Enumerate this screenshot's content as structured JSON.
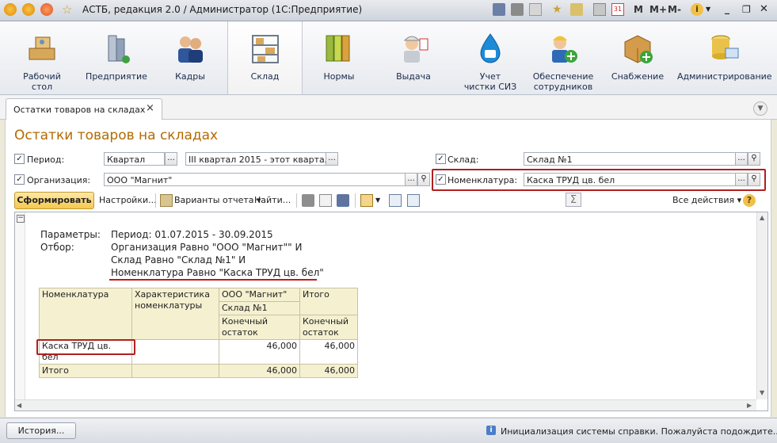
{
  "window": {
    "title": "АСТБ, редакция 2.0 / Администратор  (1С:Предприятие)",
    "mplus": [
      "M",
      "M+",
      "M-"
    ]
  },
  "sections": [
    {
      "label": "Рабочий\nстол",
      "icon": "desk-icon"
    },
    {
      "label": "Предприятие",
      "icon": "building-icon"
    },
    {
      "label": "Кадры",
      "icon": "people-icon"
    },
    {
      "label": "Склад",
      "icon": "warehouse-shelf-icon"
    },
    {
      "label": "Нормы",
      "icon": "binders-icon"
    },
    {
      "label": "Выдача",
      "icon": "worker-icon"
    },
    {
      "label": "Учет\nчистки СИЗ",
      "icon": "water-drop-icon"
    },
    {
      "label": "Обеспечение\nсотрудников",
      "icon": "worker-add-icon"
    },
    {
      "label": "Снабжение",
      "icon": "box-add-icon"
    },
    {
      "label": "Администрирование",
      "icon": "database-icon"
    }
  ],
  "tab": {
    "label": "Остатки товаров на складах",
    "close": "×"
  },
  "page": {
    "title": "Остатки товаров на складах"
  },
  "filters": {
    "period_label": "Период:",
    "period_kind": "Квартал",
    "period_value": "III квартал 2015 - этот квартал",
    "org_label": "Организация:",
    "org_value": "ООО \"Магнит\"",
    "warehouse_label": "Склад:",
    "warehouse_value": "Склад №1",
    "nomenclature_label": "Номенклатура:",
    "nomenclature_value": "Каска ТРУД цв. бел",
    "dots": "...",
    "magnifier": "🔍"
  },
  "toolbar": {
    "form_button": "Сформировать",
    "settings": "Настройки...",
    "variants": "Варианты отчета",
    "find": "Найти...",
    "all_actions": "Все действия",
    "sum": "Σ",
    "help": "?"
  },
  "report": {
    "params_label": "Параметры:",
    "params_value": "Период: 01.07.2015 - 30.09.2015",
    "filter_label": "Отбор:",
    "filter_lines": [
      "Организация Равно \"ООО \"Магнит\"\" И",
      "Склад Равно \"Склад №1\" И",
      "Номенклатура Равно \"Каска ТРУД цв. бел\""
    ],
    "table": {
      "col_nomenclature": "Номенклатура",
      "col_characteristic": "Характеристика номенклатуры",
      "col_org": "ООО \"Магнит\"",
      "col_warehouse": "Склад №1",
      "col_total": "Итого",
      "col_end_balance": "Конечный остаток",
      "rows": [
        {
          "name": "Каска ТРУД цв. бел",
          "char": "",
          "org_value": "46,000",
          "total": "46,000"
        }
      ],
      "total_label": "Итого",
      "total_org": "46,000",
      "total_total": "46,000"
    }
  },
  "status": {
    "history_button": "История...",
    "message": "Инициализация системы справки. Пожалуйста подождите..."
  }
}
